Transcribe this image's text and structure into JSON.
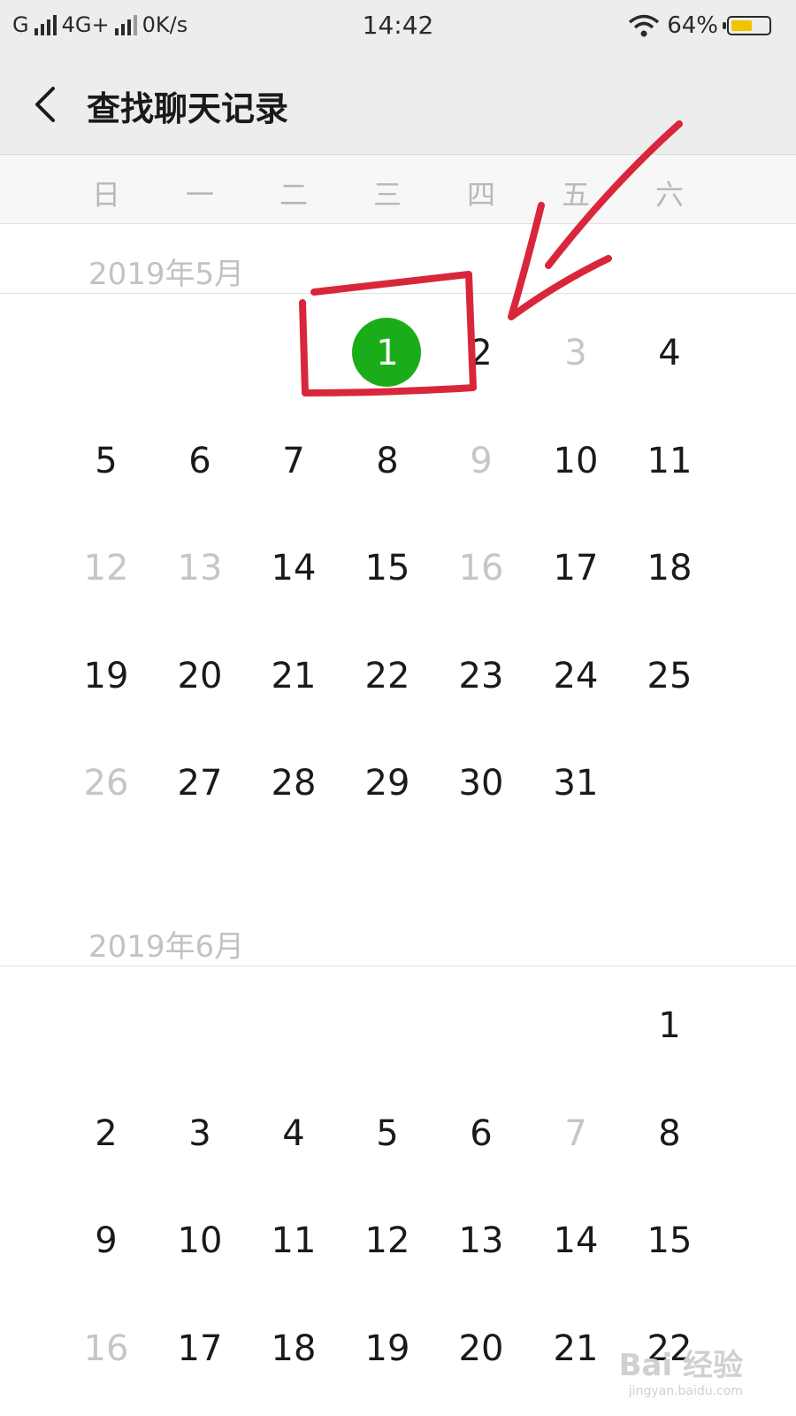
{
  "status_bar": {
    "carrier1": "G",
    "carrier2": "4G+",
    "net_speed": "0K/s",
    "time": "14:42",
    "battery_text": "64%",
    "battery_level": 0.64,
    "battery_color": "#f2c300"
  },
  "header": {
    "back_icon": "back-chevron-icon",
    "title": "查找聊天记录"
  },
  "weekdays": [
    "日",
    "一",
    "二",
    "三",
    "四",
    "五",
    "六"
  ],
  "months": [
    {
      "label": "2019年5月",
      "days": [
        {
          "d": "1",
          "col": 3,
          "row": 0,
          "state": "selected"
        },
        {
          "d": "2",
          "col": 4,
          "row": 0,
          "state": "active"
        },
        {
          "d": "3",
          "col": 5,
          "row": 0,
          "state": "muted"
        },
        {
          "d": "4",
          "col": 6,
          "row": 0,
          "state": "active"
        },
        {
          "d": "5",
          "col": 0,
          "row": 1,
          "state": "active"
        },
        {
          "d": "6",
          "col": 1,
          "row": 1,
          "state": "active"
        },
        {
          "d": "7",
          "col": 2,
          "row": 1,
          "state": "active"
        },
        {
          "d": "8",
          "col": 3,
          "row": 1,
          "state": "active"
        },
        {
          "d": "9",
          "col": 4,
          "row": 1,
          "state": "muted"
        },
        {
          "d": "10",
          "col": 5,
          "row": 1,
          "state": "active"
        },
        {
          "d": "11",
          "col": 6,
          "row": 1,
          "state": "active"
        },
        {
          "d": "12",
          "col": 0,
          "row": 2,
          "state": "muted"
        },
        {
          "d": "13",
          "col": 1,
          "row": 2,
          "state": "muted"
        },
        {
          "d": "14",
          "col": 2,
          "row": 2,
          "state": "active"
        },
        {
          "d": "15",
          "col": 3,
          "row": 2,
          "state": "active"
        },
        {
          "d": "16",
          "col": 4,
          "row": 2,
          "state": "muted"
        },
        {
          "d": "17",
          "col": 5,
          "row": 2,
          "state": "active"
        },
        {
          "d": "18",
          "col": 6,
          "row": 2,
          "state": "active"
        },
        {
          "d": "19",
          "col": 0,
          "row": 3,
          "state": "active"
        },
        {
          "d": "20",
          "col": 1,
          "row": 3,
          "state": "active"
        },
        {
          "d": "21",
          "col": 2,
          "row": 3,
          "state": "active"
        },
        {
          "d": "22",
          "col": 3,
          "row": 3,
          "state": "active"
        },
        {
          "d": "23",
          "col": 4,
          "row": 3,
          "state": "active"
        },
        {
          "d": "24",
          "col": 5,
          "row": 3,
          "state": "active"
        },
        {
          "d": "25",
          "col": 6,
          "row": 3,
          "state": "active"
        },
        {
          "d": "26",
          "col": 0,
          "row": 4,
          "state": "muted"
        },
        {
          "d": "27",
          "col": 1,
          "row": 4,
          "state": "active"
        },
        {
          "d": "28",
          "col": 2,
          "row": 4,
          "state": "active"
        },
        {
          "d": "29",
          "col": 3,
          "row": 4,
          "state": "active"
        },
        {
          "d": "30",
          "col": 4,
          "row": 4,
          "state": "active"
        },
        {
          "d": "31",
          "col": 5,
          "row": 4,
          "state": "active"
        }
      ]
    },
    {
      "label": "2019年6月",
      "days": [
        {
          "d": "1",
          "col": 6,
          "row": 0,
          "state": "active"
        },
        {
          "d": "2",
          "col": 0,
          "row": 1,
          "state": "active"
        },
        {
          "d": "3",
          "col": 1,
          "row": 1,
          "state": "active"
        },
        {
          "d": "4",
          "col": 2,
          "row": 1,
          "state": "active"
        },
        {
          "d": "5",
          "col": 3,
          "row": 1,
          "state": "active"
        },
        {
          "d": "6",
          "col": 4,
          "row": 1,
          "state": "active"
        },
        {
          "d": "7",
          "col": 5,
          "row": 1,
          "state": "muted"
        },
        {
          "d": "8",
          "col": 6,
          "row": 1,
          "state": "active"
        },
        {
          "d": "9",
          "col": 0,
          "row": 2,
          "state": "active"
        },
        {
          "d": "10",
          "col": 1,
          "row": 2,
          "state": "active"
        },
        {
          "d": "11",
          "col": 2,
          "row": 2,
          "state": "active"
        },
        {
          "d": "12",
          "col": 3,
          "row": 2,
          "state": "active"
        },
        {
          "d": "13",
          "col": 4,
          "row": 2,
          "state": "active"
        },
        {
          "d": "14",
          "col": 5,
          "row": 2,
          "state": "active"
        },
        {
          "d": "15",
          "col": 6,
          "row": 2,
          "state": "active"
        },
        {
          "d": "16",
          "col": 0,
          "row": 3,
          "state": "muted"
        },
        {
          "d": "17",
          "col": 1,
          "row": 3,
          "state": "active"
        },
        {
          "d": "18",
          "col": 2,
          "row": 3,
          "state": "active"
        },
        {
          "d": "19",
          "col": 3,
          "row": 3,
          "state": "active"
        },
        {
          "d": "20",
          "col": 4,
          "row": 3,
          "state": "active"
        },
        {
          "d": "21",
          "col": 5,
          "row": 3,
          "state": "active"
        },
        {
          "d": "22",
          "col": 6,
          "row": 3,
          "state": "active"
        }
      ]
    }
  ],
  "colors": {
    "selected": "#1aad19",
    "annotation": "#d9263b"
  },
  "watermark": {
    "brand": "Bai 经验",
    "url": "jingyan.baidu.com"
  }
}
